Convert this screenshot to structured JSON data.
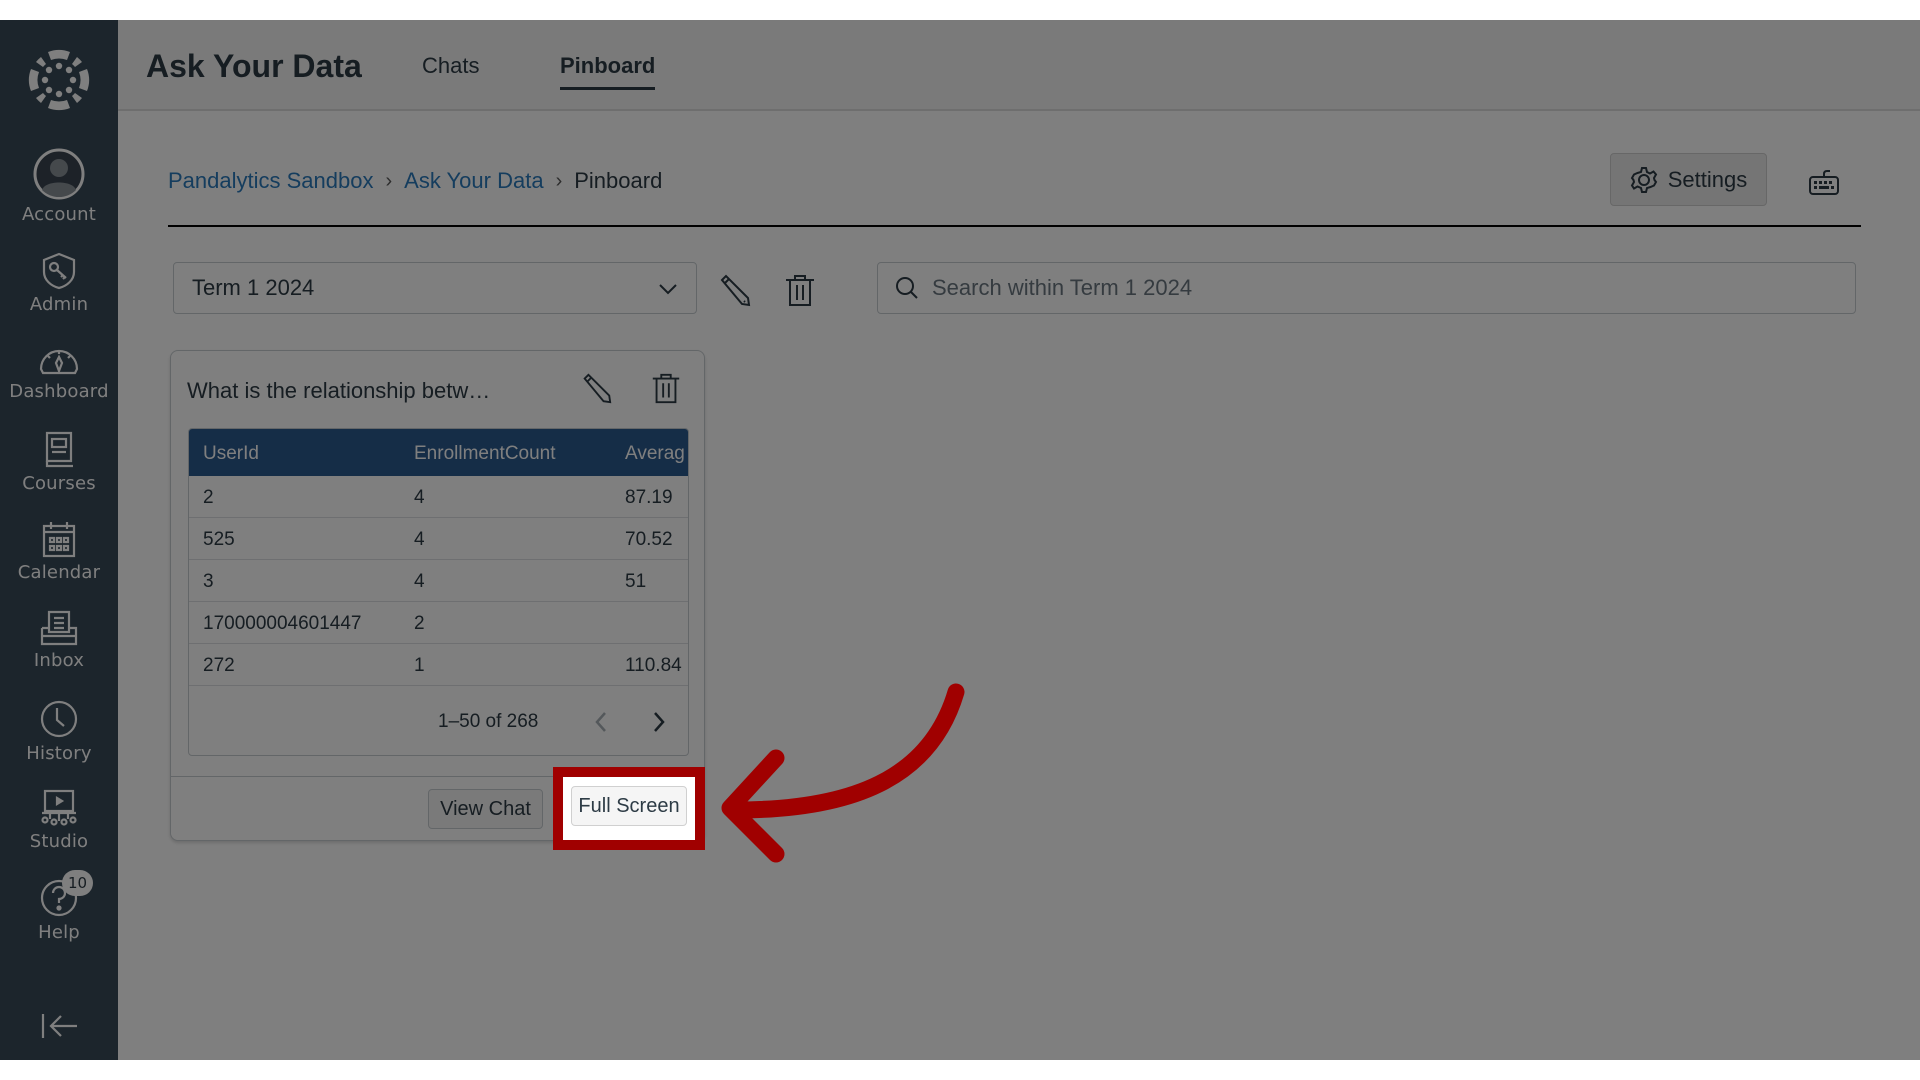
{
  "sidebar": {
    "logo": "canvas-logo-icon",
    "items": [
      {
        "label": "Account",
        "icon": "account-avatar-icon"
      },
      {
        "label": "Admin",
        "icon": "admin-shield-icon"
      },
      {
        "label": "Dashboard",
        "icon": "dashboard-gauge-icon"
      },
      {
        "label": "Courses",
        "icon": "courses-book-icon"
      },
      {
        "label": "Calendar",
        "icon": "calendar-icon"
      },
      {
        "label": "Inbox",
        "icon": "inbox-icon"
      },
      {
        "label": "History",
        "icon": "history-clock-icon"
      },
      {
        "label": "Studio",
        "icon": "studio-icon"
      },
      {
        "label": "Help",
        "icon": "help-icon",
        "badge": "10"
      }
    ],
    "collapse_icon": "collapse-arrow-icon"
  },
  "header": {
    "title": "Ask Your Data",
    "tabs": [
      {
        "label": "Chats",
        "active": false
      },
      {
        "label": "Pinboard",
        "active": true
      }
    ]
  },
  "breadcrumb": {
    "items": [
      "Pandalytics Sandbox",
      "Ask Your Data",
      "Pinboard"
    ]
  },
  "toolbar": {
    "settings_label": "Settings",
    "keyboard_icon": "keyboard-shortcuts-icon"
  },
  "filters": {
    "term_selected": "Term 1 2024",
    "search_placeholder": "Search within Term 1 2024"
  },
  "card": {
    "title": "What is the relationship betw…",
    "table": {
      "columns": [
        "UserId",
        "EnrollmentCount",
        "Averag"
      ],
      "rows": [
        [
          "2",
          "4",
          "87.19"
        ],
        [
          "525",
          "4",
          "70.52"
        ],
        [
          "3",
          "4",
          "51"
        ],
        [
          "170000004601447",
          "2",
          ""
        ],
        [
          "272",
          "1",
          "110.84"
        ]
      ]
    },
    "pagination": "1–50 of 268",
    "view_chat_label": "View Chat",
    "full_screen_label": "Full Screen"
  },
  "annotation": {
    "highlight_color": "#a00000",
    "target": "Full Screen"
  }
}
